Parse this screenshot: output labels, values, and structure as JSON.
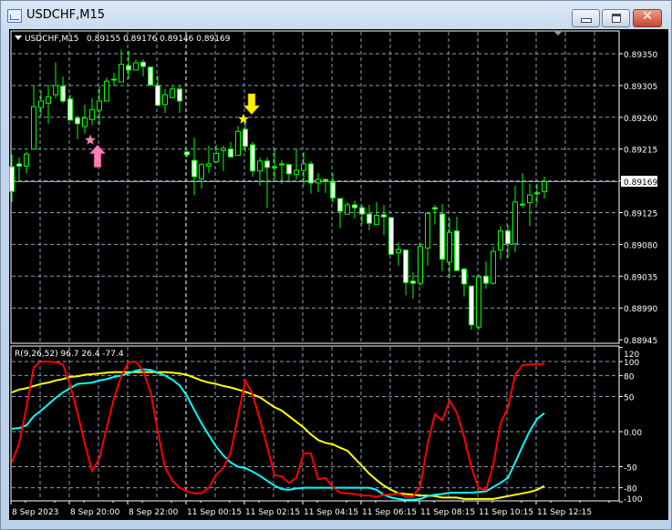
{
  "window": {
    "title": "USDCHF,M15",
    "close_glyph": "✕"
  },
  "chart": {
    "header_symbol": "USDCHF,M15",
    "header_ohlc": "0.89155 0.89176 0.89146 0.89169",
    "current_price_label": "0.89169",
    "price_labels": [
      "0.89350",
      "0.89305",
      "0.89260",
      "0.89215",
      "0.89125",
      "0.89080",
      "0.89035",
      "0.88990",
      "0.88945"
    ],
    "time_labels": [
      "8 Sep 2023",
      "8 Sep 20:00",
      "8 Sep 22:00",
      "11 Sep 00:15",
      "11 Sep 02:15",
      "11 Sep 04:15",
      "11 Sep 06:15",
      "11 Sep 08:15",
      "11 Sep 10:15",
      "11 Sep 12:15"
    ],
    "indicator_header": "R(9,26,52) 96.7 26.4 -77.4",
    "indicator_labels": [
      "120",
      "100",
      "80",
      "50",
      "0.00",
      "-50",
      "-80",
      "-100"
    ]
  },
  "colors": {
    "bg": "#000000",
    "candle": "#00ff00",
    "bull_fill": "#000000",
    "bear_fill": "#ffffff",
    "grid": "#8a9bb0",
    "red": "#ff0000",
    "cyan": "#00ffff",
    "yellow": "#ffff00",
    "buy": "#ff7fb0",
    "sell": "#ffee00"
  },
  "chart_data": [
    {
      "type": "candlestick",
      "title": "USDCHF,M15",
      "ylim": [
        0.88945,
        0.8935
      ],
      "current_price": 0.89169,
      "ohlc": [
        [
          0.8919,
          0.89207,
          0.8914,
          0.89155
        ],
        [
          0.89194,
          0.89203,
          0.89168,
          0.89191
        ],
        [
          0.89191,
          0.89211,
          0.89181,
          0.89208
        ],
        [
          0.89215,
          0.89305,
          0.89215,
          0.89275
        ],
        [
          0.89274,
          0.89297,
          0.89262,
          0.89283
        ],
        [
          0.8928,
          0.89306,
          0.89251,
          0.89289
        ],
        [
          0.89292,
          0.89338,
          0.89287,
          0.89305
        ],
        [
          0.89304,
          0.89318,
          0.8928,
          0.89283
        ],
        [
          0.89286,
          0.89292,
          0.89256,
          0.89256
        ],
        [
          0.89259,
          0.89262,
          0.89229,
          0.89251
        ],
        [
          0.89247,
          0.89278,
          0.89237,
          0.89259
        ],
        [
          0.89257,
          0.89287,
          0.89249,
          0.89271
        ],
        [
          0.8927,
          0.89304,
          0.89249,
          0.89283
        ],
        [
          0.89283,
          0.89316,
          0.89283,
          0.89311
        ],
        [
          0.89314,
          0.89323,
          0.89304,
          0.89313
        ],
        [
          0.8931,
          0.89356,
          0.8931,
          0.89335
        ],
        [
          0.89333,
          0.89354,
          0.89314,
          0.89327
        ],
        [
          0.89327,
          0.89342,
          0.89327,
          0.89337
        ],
        [
          0.89338,
          0.89342,
          0.89318,
          0.89332
        ],
        [
          0.89331,
          0.89332,
          0.89304,
          0.89306
        ],
        [
          0.89305,
          0.89319,
          0.89275,
          0.89277
        ],
        [
          0.89278,
          0.893,
          0.89266,
          0.89292
        ],
        [
          0.89288,
          0.89305,
          0.89287,
          0.893
        ],
        [
          0.893,
          0.89305,
          0.89266,
          0.89283
        ],
        [
          0.89211,
          0.89213,
          0.89203,
          0.89207
        ],
        [
          0.89199,
          0.89231,
          0.8915,
          0.89176
        ],
        [
          0.89173,
          0.89195,
          0.89159,
          0.89193
        ],
        [
          0.89191,
          0.8922,
          0.89181,
          0.89194
        ],
        [
          0.89197,
          0.89221,
          0.89195,
          0.89209
        ],
        [
          0.89213,
          0.8922,
          0.89184,
          0.89216
        ],
        [
          0.89215,
          0.89225,
          0.89203,
          0.89204
        ],
        [
          0.89206,
          0.89248,
          0.89206,
          0.8924
        ],
        [
          0.89243,
          0.89256,
          0.89211,
          0.89219
        ],
        [
          0.89221,
          0.89225,
          0.89176,
          0.89184
        ],
        [
          0.89184,
          0.89203,
          0.89163,
          0.89198
        ],
        [
          0.89198,
          0.89203,
          0.89132,
          0.89189
        ],
        [
          0.8919,
          0.89216,
          0.89172,
          0.89189
        ],
        [
          0.89194,
          0.89199,
          0.89166,
          0.89194
        ],
        [
          0.89193,
          0.89194,
          0.89171,
          0.8918
        ],
        [
          0.89179,
          0.89216,
          0.89172,
          0.89185
        ],
        [
          0.89185,
          0.89211,
          0.89163,
          0.89194
        ],
        [
          0.89194,
          0.89198,
          0.89152,
          0.89167
        ],
        [
          0.89167,
          0.89181,
          0.89154,
          0.89172
        ],
        [
          0.89172,
          0.89172,
          0.89153,
          0.8917
        ],
        [
          0.89168,
          0.89181,
          0.89139,
          0.89146
        ],
        [
          0.89145,
          0.89145,
          0.89103,
          0.89127
        ],
        [
          0.89123,
          0.8914,
          0.89122,
          0.89136
        ],
        [
          0.89136,
          0.89142,
          0.89117,
          0.89132
        ],
        [
          0.89132,
          0.89136,
          0.89108,
          0.89123
        ],
        [
          0.89123,
          0.89136,
          0.891,
          0.8911
        ],
        [
          0.89108,
          0.8914,
          0.89108,
          0.89121
        ],
        [
          0.89122,
          0.89136,
          0.89093,
          0.89119
        ],
        [
          0.89118,
          0.89118,
          0.89066,
          0.89066
        ],
        [
          0.89068,
          0.89083,
          0.8905,
          0.89073
        ],
        [
          0.89072,
          0.89072,
          0.89008,
          0.89026
        ],
        [
          0.89028,
          0.89041,
          0.89003,
          0.89025
        ],
        [
          0.89025,
          0.89082,
          0.89021,
          0.89077
        ],
        [
          0.89075,
          0.89126,
          0.8905,
          0.89124
        ],
        [
          0.89132,
          0.89136,
          0.89108,
          0.8913
        ],
        [
          0.89123,
          0.89137,
          0.89042,
          0.89059
        ],
        [
          0.89055,
          0.89117,
          0.89032,
          0.89097
        ],
        [
          0.89099,
          0.89119,
          0.89043,
          0.89043
        ],
        [
          0.89045,
          0.89047,
          0.89006,
          0.89024
        ],
        [
          0.89021,
          0.89021,
          0.88959,
          0.88966
        ],
        [
          0.88963,
          0.89037,
          0.88959,
          0.89034
        ],
        [
          0.89035,
          0.89056,
          0.89017,
          0.89025
        ],
        [
          0.89025,
          0.89077,
          0.89023,
          0.8907
        ],
        [
          0.89072,
          0.89106,
          0.89059,
          0.89099
        ],
        [
          0.89099,
          0.89108,
          0.89061,
          0.89081
        ],
        [
          0.89081,
          0.89163,
          0.89069,
          0.8914
        ],
        [
          0.89137,
          0.89181,
          0.89132,
          0.89137
        ],
        [
          0.89139,
          0.89166,
          0.89106,
          0.8915
        ],
        [
          0.89153,
          0.89166,
          0.89137,
          0.89153
        ],
        [
          0.89155,
          0.89176,
          0.89145,
          0.89169
        ]
      ],
      "signals": [
        {
          "type": "buy",
          "bar": 11,
          "price": 0.89229
        },
        {
          "type": "sell",
          "bar": 32,
          "price": 0.8926
        }
      ],
      "session_separator_bar": 24
    },
    {
      "type": "line",
      "title": "R(9,26,52)",
      "ylim": [
        -100,
        120
      ],
      "gridlines": [
        100,
        80,
        50,
        0,
        -50,
        -80
      ],
      "series": [
        {
          "name": "R9",
          "color": "red",
          "values": [
            -44,
            -17,
            35,
            92,
            100,
            100,
            99,
            96,
            66,
            27,
            -17,
            -56,
            -38,
            5,
            48,
            79,
            99,
            100,
            87,
            57,
            1,
            -51,
            -70,
            -80,
            -85,
            -88,
            -88,
            -80,
            -62,
            -51,
            -30,
            22,
            73,
            53,
            18,
            -21,
            -62,
            -64,
            -73,
            -66,
            -31,
            -31,
            -68,
            -66,
            -79,
            -87,
            -88,
            -89,
            -91,
            -91,
            -93,
            -90,
            -90,
            -88,
            -93,
            -93,
            -77,
            -17,
            25,
            16,
            44,
            27,
            -8,
            -51,
            -81,
            -83,
            -47,
            12,
            34,
            81,
            95,
            96,
            96,
            96.7
          ]
        },
        {
          "name": "R26",
          "color": "cyan",
          "values": [
            4,
            5,
            9,
            22,
            30,
            39,
            48,
            56,
            62,
            68,
            69,
            70,
            73,
            75,
            78,
            80,
            83,
            87,
            89,
            88,
            84,
            80,
            74,
            66,
            51,
            31,
            12,
            -5,
            -21,
            -34,
            -44,
            -50,
            -52,
            -57,
            -63,
            -70,
            -77,
            -82,
            -83,
            -81,
            -80,
            -80,
            -80,
            -80,
            -80,
            -80,
            -80,
            -80,
            -80,
            -80,
            -83,
            -90,
            -94,
            -96,
            -97,
            -97,
            -96,
            -92,
            -90,
            -89,
            -87,
            -87,
            -87,
            -87,
            -86,
            -85,
            -79,
            -73,
            -66,
            -44,
            -21,
            1,
            18,
            26.4
          ]
        },
        {
          "name": "R52",
          "color": "yellow",
          "values": [
            56,
            60,
            62,
            65,
            68,
            70,
            73,
            75,
            78,
            79,
            81,
            82,
            83,
            84,
            85,
            85,
            85,
            85,
            85,
            85,
            85,
            85,
            84,
            83,
            81,
            77,
            73,
            70,
            68,
            65,
            63,
            60,
            57,
            53,
            49,
            42,
            35,
            30,
            22,
            14,
            6,
            -4,
            -12,
            -16,
            -18,
            -23,
            -27,
            -38,
            -49,
            -60,
            -69,
            -77,
            -83,
            -88,
            -89,
            -90,
            -91,
            -91,
            -92,
            -94,
            -94,
            -94,
            -96,
            -96,
            -96,
            -96,
            -96,
            -94,
            -92,
            -90,
            -88,
            -86,
            -83,
            -77.4
          ]
        }
      ]
    }
  ]
}
